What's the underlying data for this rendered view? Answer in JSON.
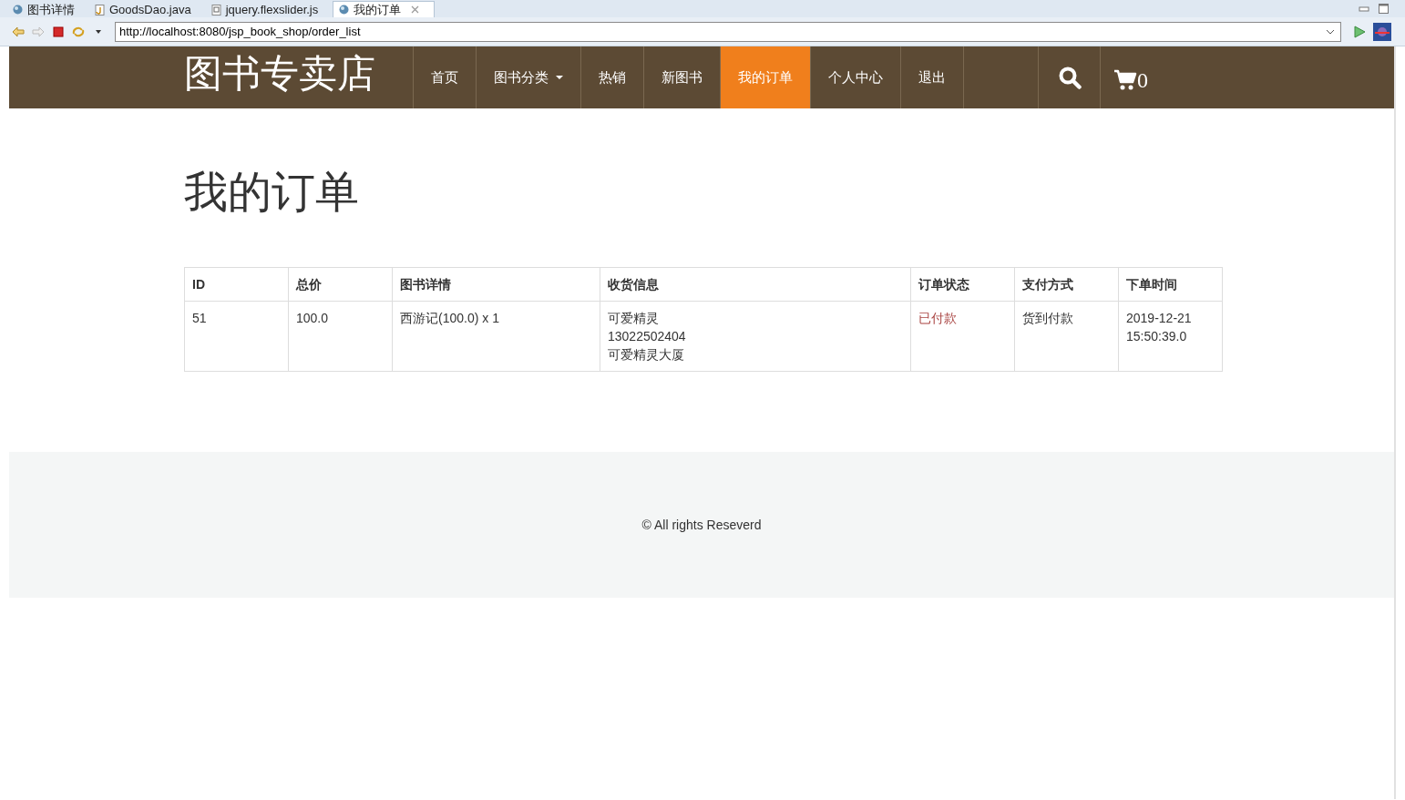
{
  "browser": {
    "tabs": [
      {
        "label": "图书详情",
        "kind": "page",
        "selected": false
      },
      {
        "label": "GoodsDao.java",
        "kind": "java",
        "selected": false
      },
      {
        "label": "jquery.flexslider.js",
        "kind": "js",
        "selected": false
      },
      {
        "label": "我的订单",
        "kind": "page",
        "selected": true
      }
    ],
    "url": "http://localhost:8080/jsp_book_shop/order_list"
  },
  "navbar": {
    "brand": "图书专卖店",
    "items": [
      {
        "label": "首页",
        "dropdown": false,
        "selected": false
      },
      {
        "label": "图书分类",
        "dropdown": true,
        "selected": false
      },
      {
        "label": "热销",
        "dropdown": false,
        "selected": false
      },
      {
        "label": "新图书",
        "dropdown": false,
        "selected": false
      },
      {
        "label": "我的订单",
        "dropdown": false,
        "selected": true
      },
      {
        "label": "个人中心",
        "dropdown": false,
        "selected": false
      },
      {
        "label": "退出",
        "dropdown": false,
        "selected": false
      }
    ],
    "cart_count": "0"
  },
  "heading": "我的订单",
  "table": {
    "columns": [
      "ID",
      "总价",
      "图书详情",
      "收货信息",
      "订单状态",
      "支付方式",
      "下单时间"
    ],
    "rows": [
      {
        "cells": [
          [
            "51"
          ],
          [
            "100.0"
          ],
          [
            "西游记(100.0) x 1"
          ],
          [
            "可爱精灵",
            "13022502404",
            "可爱精灵大厦"
          ],
          [
            "已付款"
          ],
          [
            "货到付款"
          ],
          [
            "2019-12-21",
            "15:50:39.0"
          ]
        ]
      }
    ]
  },
  "footer": "© All rights Reseverd"
}
